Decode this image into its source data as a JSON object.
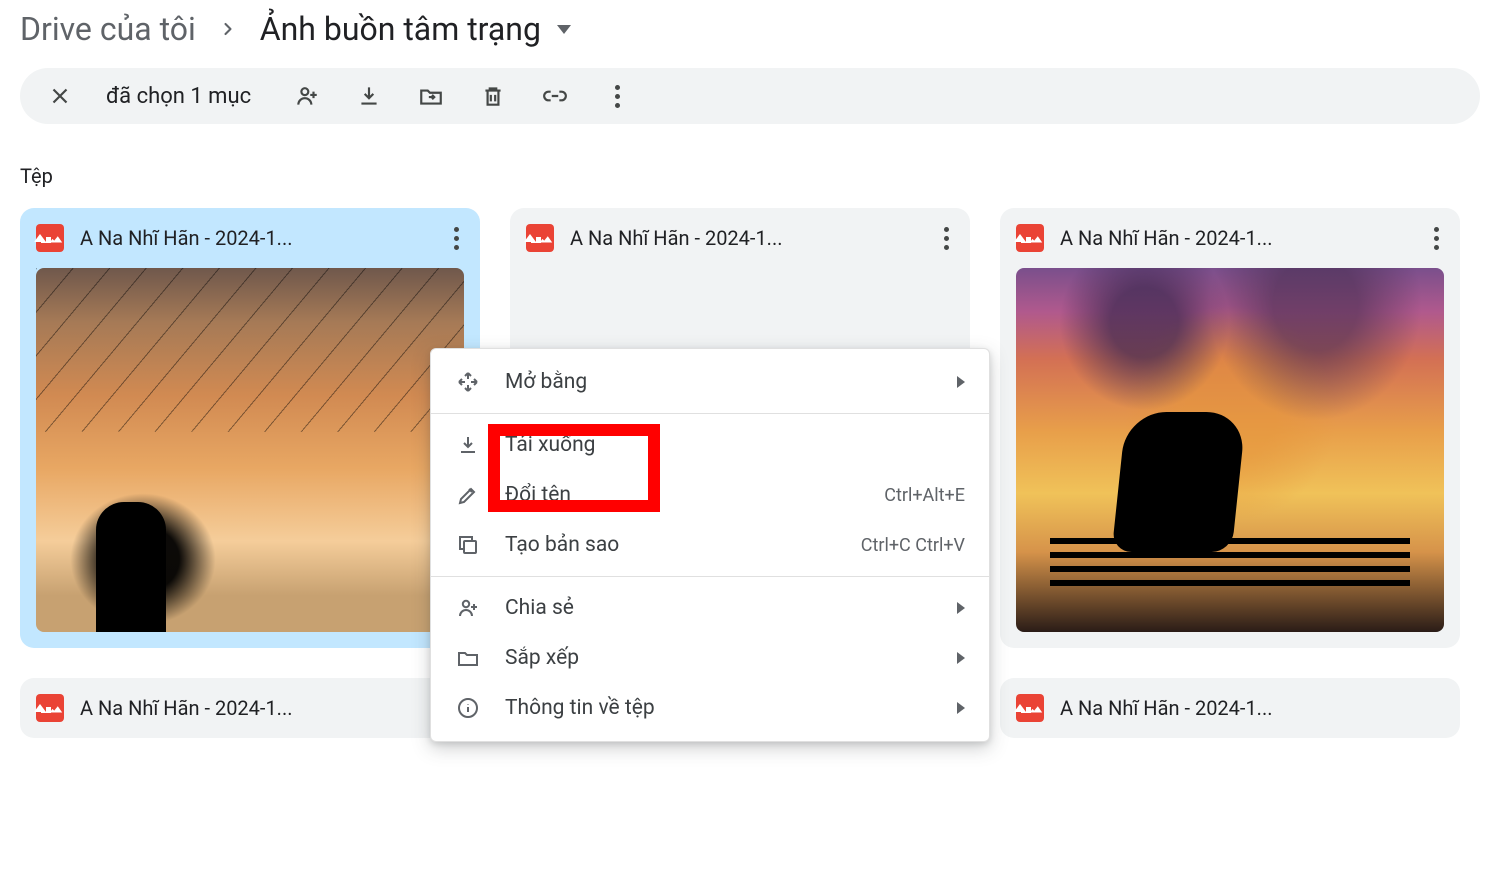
{
  "breadcrumb": {
    "root": "Drive của tôi",
    "current": "Ảnh buồn tâm trạng"
  },
  "selection_bar": {
    "text": "đã chọn 1 mục"
  },
  "section_label": "Tệp",
  "files": [
    {
      "name": "A Na Nhĩ Hãn - 2024-1..."
    },
    {
      "name": "A Na Nhĩ Hãn - 2024-1..."
    },
    {
      "name": "A Na Nhĩ Hãn - 2024-1..."
    },
    {
      "name": "A Na Nhĩ Hãn - 2024-1..."
    },
    {
      "name": "A Na Nhĩ Hãn - 2024-1..."
    }
  ],
  "context_menu": {
    "open_with": "Mở bằng",
    "download": "Tải xuống",
    "rename": {
      "label": "Đổi tên",
      "shortcut": "Ctrl+Alt+E"
    },
    "copy": {
      "label": "Tạo bản sao",
      "shortcut": "Ctrl+C Ctrl+V"
    },
    "share": "Chia sẻ",
    "organize": "Sắp xếp",
    "info": "Thông tin về tệp"
  },
  "colors": {
    "accent_selected": "#c2e7ff",
    "icon_red": "#ea4335",
    "highlight": "#ff0000"
  }
}
